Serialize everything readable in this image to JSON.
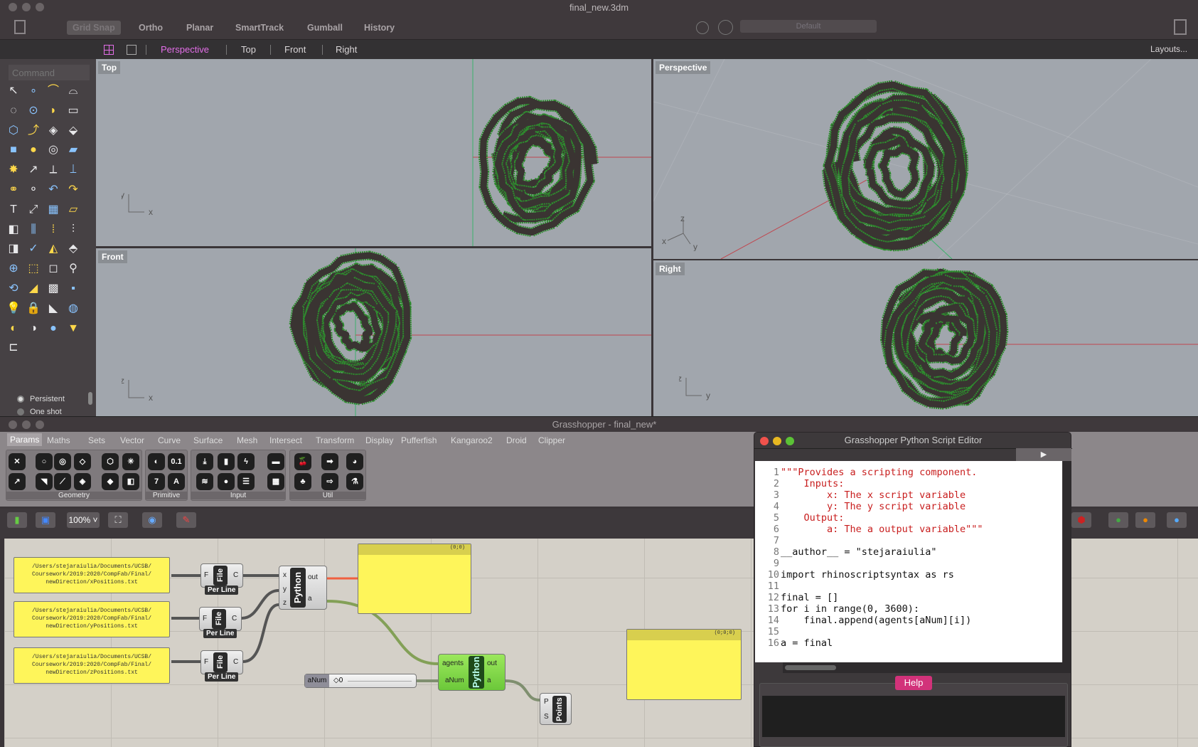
{
  "rhino": {
    "title": "final_new.3dm",
    "toolbar": [
      "Grid Snap",
      "Ortho",
      "Planar",
      "SmartTrack",
      "Gumball",
      "History"
    ],
    "layer": "Default",
    "viewport_tabs": [
      "Perspective",
      "Top",
      "Front",
      "Right"
    ],
    "active_tab": "Perspective",
    "layouts": "Layouts...",
    "command_placeholder": "Command",
    "osnap": [
      "Persistent",
      "One shot"
    ],
    "viewports": {
      "top": "Top",
      "perspective": "Perspective",
      "front": "Front",
      "right": "Right"
    },
    "axes": {
      "top": [
        "y",
        "x"
      ],
      "front": [
        "z",
        "x"
      ],
      "right": [
        "z",
        "y"
      ],
      "persp": [
        "z",
        "x",
        "y"
      ]
    }
  },
  "grasshopper": {
    "title": "Grasshopper - final_new*",
    "tabs": [
      "Params",
      "Maths",
      "Sets",
      "Vector",
      "Curve",
      "Surface",
      "Mesh",
      "Intersect",
      "Transform",
      "Display",
      "Pufferfish",
      "Kangaroo2",
      "Droid",
      "Clipper"
    ],
    "ribbon_groups": [
      "Geometry",
      "Primitive",
      "Input",
      "Util"
    ],
    "zoom": "100%",
    "panels": [
      "/Users/stejaraiulia/Documents/UCSB/ Coursework/2019:2020/CompFab/Final/ newDirection/xPositions.txt",
      "/Users/stejaraiulia/Documents/UCSB/ Coursework/2019:2020/CompFab/Final/ newDirection/yPositions.txt",
      "/Users/stejaraiulia/Documents/UCSB/ Coursework/2019:2020/CompFab/Final/ newDirection/zPositions.txt"
    ],
    "file": {
      "name": "File",
      "in": "F",
      "out": "C",
      "tag": "Per Line"
    },
    "python1": {
      "name": "Python",
      "inputs": [
        "x",
        "y",
        "z"
      ],
      "outputs": [
        "out",
        "a"
      ]
    },
    "python2": {
      "name": "Python",
      "inputs": [
        "agents",
        "aNum"
      ],
      "outputs": [
        "out",
        "a"
      ]
    },
    "output_panel1": "(0;0)",
    "output_panel2": "(0;0;0)",
    "slider": {
      "label": "aNum",
      "value": "0"
    },
    "points": {
      "name": "Points",
      "inputs": [
        "P",
        "S"
      ]
    }
  },
  "editor": {
    "title": "Grasshopper Python Script Editor",
    "help": "Help",
    "lines": [
      "\"\"\"Provides a scripting component.",
      "    Inputs:",
      "        x: The x script variable",
      "        y: The y script variable",
      "    Output:",
      "        a: The a output variable\"\"\"",
      "",
      "__author__ = \"stejaraiulia\"",
      "",
      "import rhinoscriptsyntax as rs",
      "",
      "final = []",
      "for i in range(0, 3600):",
      "    final.append(agents[aNum][i])",
      "",
      "a = final"
    ]
  },
  "colors": {
    "accent": "#e36ee8",
    "panel": "#fef55a",
    "python_active": "#8ae04a",
    "help": "#d2327a"
  }
}
